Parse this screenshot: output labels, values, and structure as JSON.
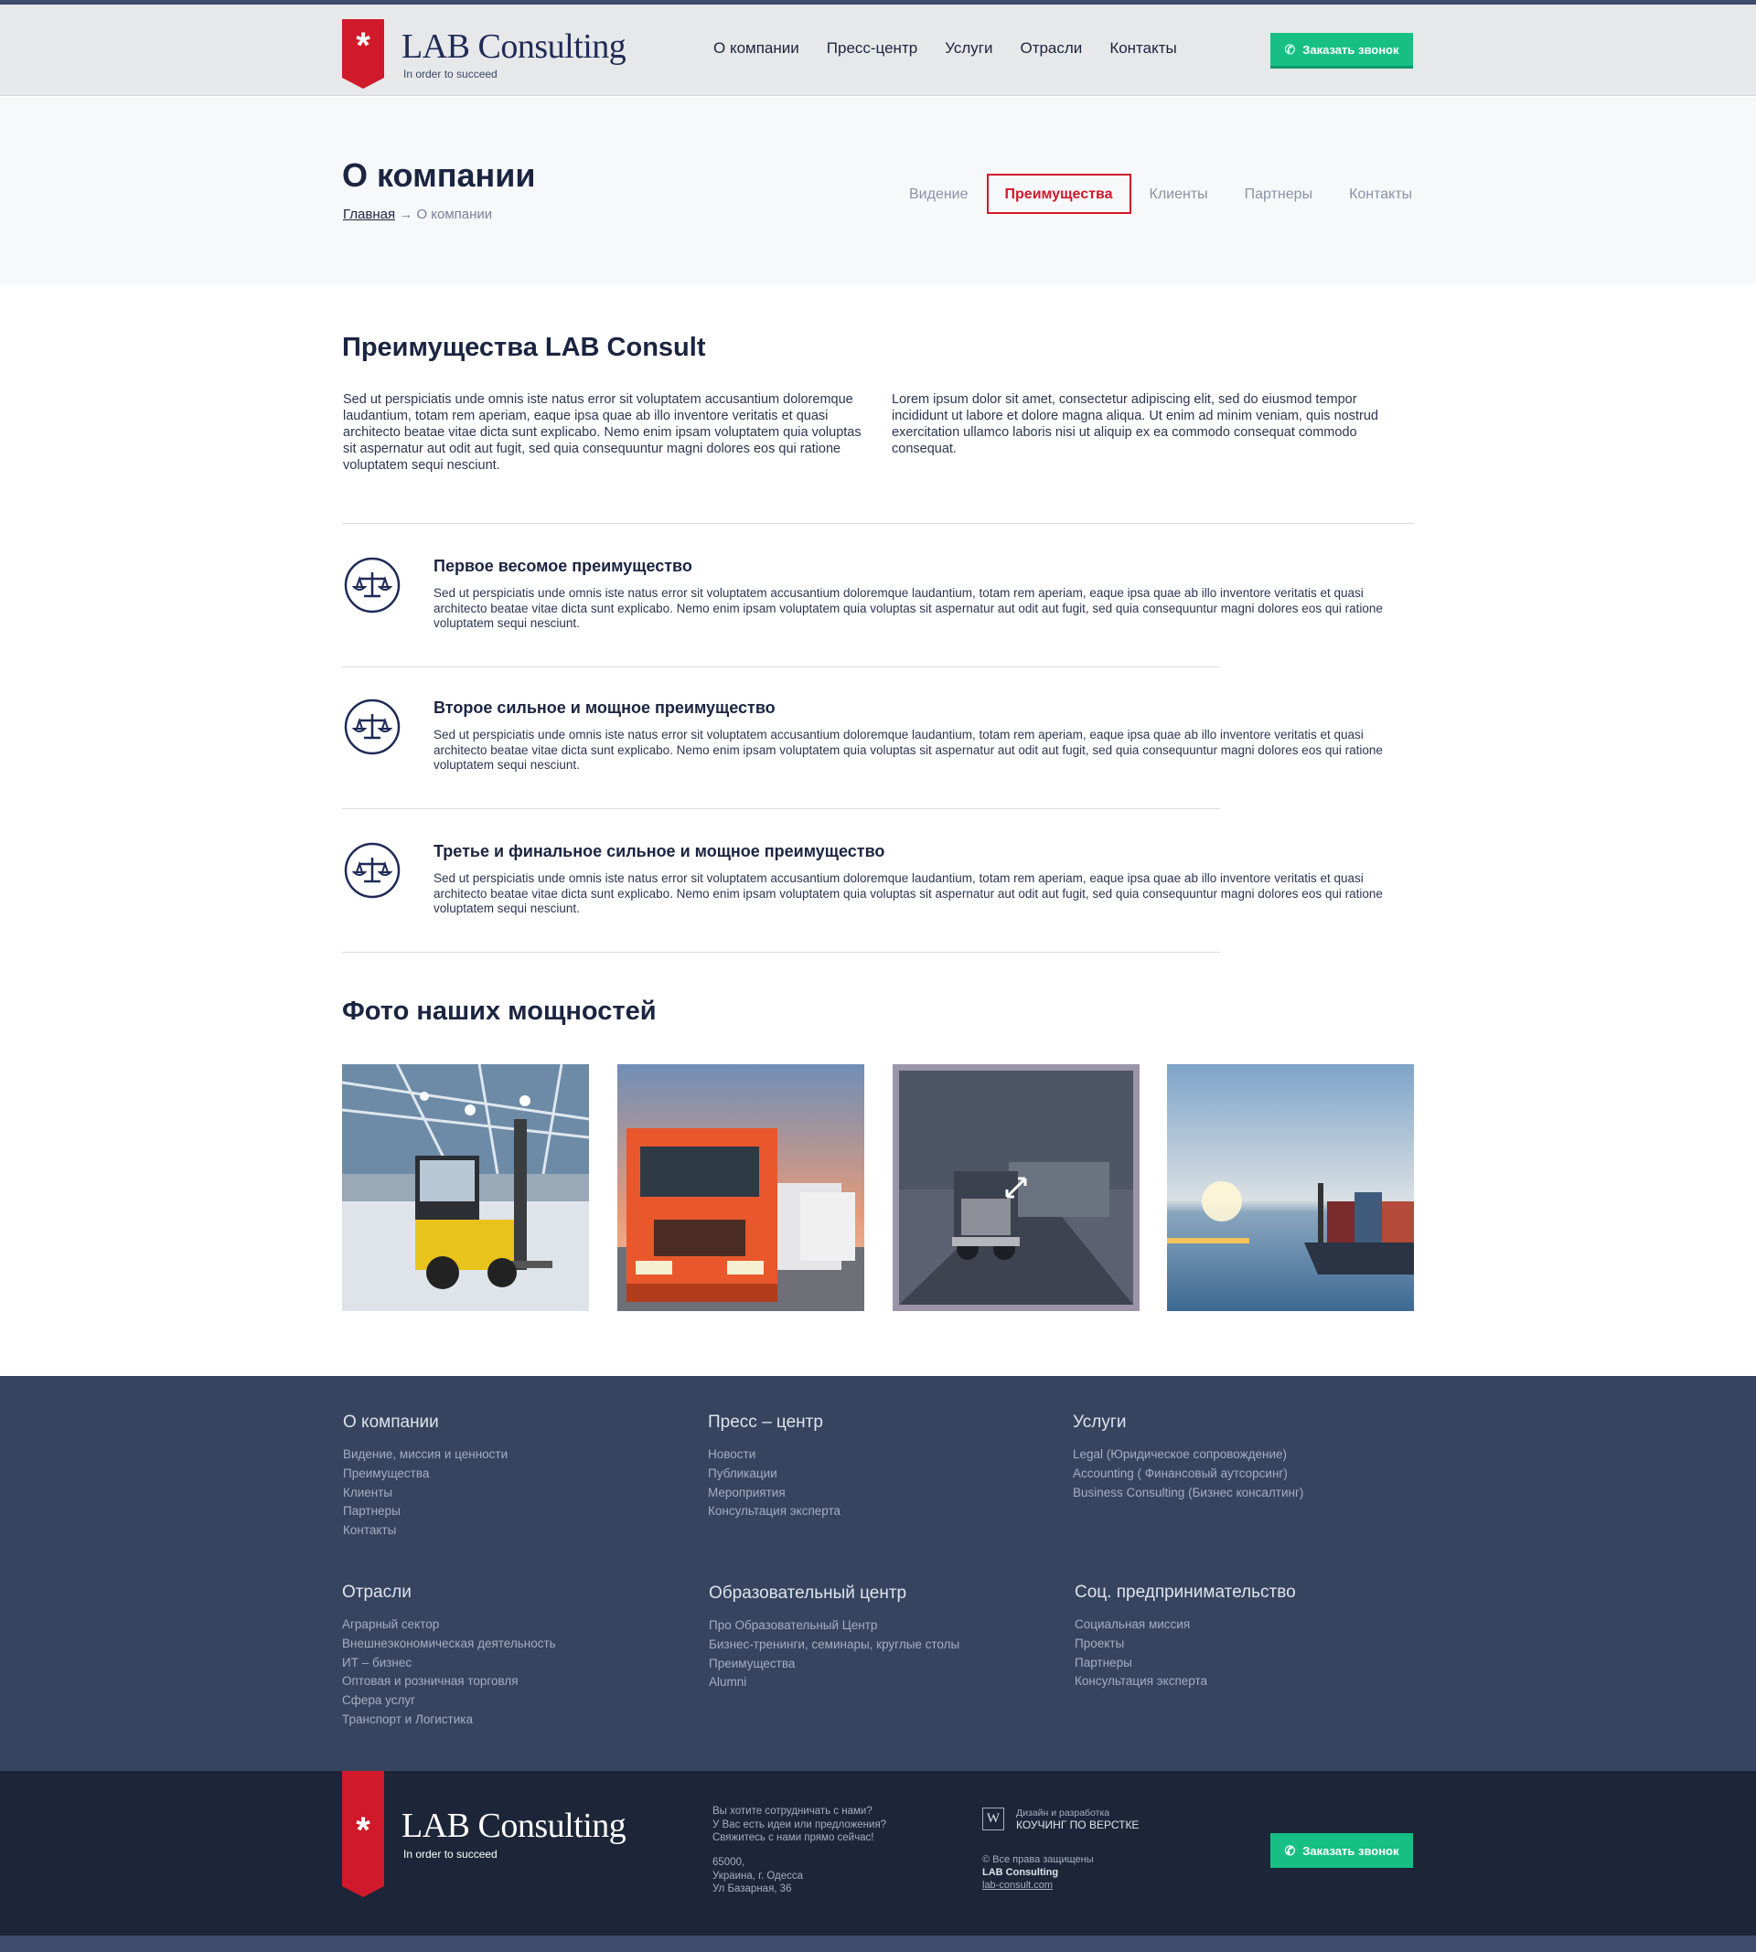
{
  "brand": {
    "name": "LAB Consulting",
    "tagline": "In order to succeed",
    "star": "*",
    "accent": "#d0192a",
    "green": "#17bf85"
  },
  "nav": [
    "О компании",
    "Пресс-центр",
    "Услуги",
    "Отрасли",
    "Контакты"
  ],
  "call_button": {
    "icon": "phone-icon",
    "label": "Заказать звонок"
  },
  "page": {
    "title": "О компании",
    "breadcrumb": {
      "home": "Главная",
      "sep": "→",
      "current": "О компании"
    },
    "tabs": [
      "Видение",
      "Преимущества",
      "Клиенты",
      "Партнеры",
      "Контакты"
    ],
    "active_tab": "Преимущества"
  },
  "advantages_section": {
    "title": "Преимущества LAB Consult",
    "intro_left": "Sed ut perspiciatis unde omnis iste natus error sit voluptatem accusantium doloremque laudantium, totam rem aperiam, eaque ipsa quae ab illo inventore veritatis et quasi architecto beatae vitae dicta sunt explicabo. Nemo enim ipsam voluptatem quia voluptas sit aspernatur aut odit aut fugit, sed quia consequuntur magni dolores eos qui ratione voluptatem sequi nesciunt.",
    "intro_right": "Lorem ipsum dolor sit amet, consectetur adipiscing elit, sed do eiusmod tempor incididunt ut labore et dolore magna aliqua. Ut enim ad minim veniam, quis nostrud exercitation ullamco laboris nisi ut aliquip ex ea commodo consequat commodo consequat.",
    "items": [
      {
        "icon": "scales-icon",
        "title": "Первое весомое преимущество",
        "text": "Sed ut perspiciatis unde omnis iste natus error sit voluptatem accusantium doloremque laudantium, totam rem aperiam, eaque ipsa quae ab illo inventore veritatis et quasi architecto beatae vitae dicta sunt explicabo. Nemo enim ipsam voluptatem quia voluptas sit aspernatur aut odit aut fugit, sed quia consequuntur magni dolores eos qui ratione voluptatem sequi nesciunt."
      },
      {
        "icon": "scales-icon",
        "title": "Второе сильное и мощное преимущество",
        "text": "Sed ut perspiciatis unde omnis iste natus error sit voluptatem accusantium doloremque laudantium, totam rem aperiam, eaque ipsa quae ab illo inventore veritatis et quasi architecto beatae vitae dicta sunt explicabo. Nemo enim ipsam voluptatem quia voluptas sit aspernatur aut odit aut fugit, sed quia consequuntur magni dolores eos qui ratione voluptatem sequi nesciunt."
      },
      {
        "icon": "scales-icon",
        "title": "Третье и финальное сильное и мощное преимущество",
        "text": "Sed ut perspiciatis unde omnis iste natus error sit voluptatem accusantium doloremque laudantium, totam rem aperiam, eaque ipsa quae ab illo inventore veritatis et quasi architecto beatae vitae dicta sunt explicabo. Nemo enim ipsam voluptatem quia voluptas sit aspernatur aut odit aut fugit, sed quia consequuntur magni dolores eos qui ratione voluptatem sequi nesciunt."
      }
    ]
  },
  "photos_section": {
    "title": "Фото наших мощностей",
    "photos": [
      "forklift-photo",
      "trucks-photo",
      "truck-road-photo",
      "cargo-ship-photo"
    ],
    "expand_icon": "expand-icon"
  },
  "footer": {
    "columns": [
      {
        "title": "О компании",
        "items": [
          "Видение, миссия и ценности",
          "Преимущества",
          "Клиенты",
          "Партнеры",
          "Контакты"
        ]
      },
      {
        "title": "Пресс – центр",
        "items": [
          "Новости",
          "Публикации",
          "Мероприятия",
          "Консультация эксперта"
        ]
      },
      {
        "title": "Услуги",
        "items": [
          "Legal (Юридическое сопровождение)",
          "Accounting ( Финансовый аутсорсинг)",
          "Business Consulting (Бизнес консалтинг)"
        ]
      },
      {
        "title": "Отрасли",
        "items": [
          "Аграрный сектор",
          "Внешнеэкономическая деятельность",
          "ИТ – бизнес",
          "Оптовая и розничная торговля",
          "Сфера услуг",
          "Транспорт и Логистика"
        ]
      },
      {
        "title": "Образовательный центр",
        "items": [
          "Про Образовательный Центр",
          "Бизнес-тренинги, семинары, круглые столы",
          "Преимущества",
          "Alumni"
        ]
      },
      {
        "title": "Соц. предпринимательство",
        "items": [
          "Социальная миссия",
          "Проекты",
          "Партнеры",
          "Консультация эксперта"
        ]
      }
    ],
    "contact_lines": [
      "Вы хотите сотрудничать с нами?",
      "У Вас есть идеи или предложения?",
      "Свяжитесь с нами прямо сейчас!"
    ],
    "address_lines": [
      "65000,",
      "Украина, г. Одесса",
      "Ул Базарная, 36"
    ],
    "design_label": "Дизайн и разработка",
    "design_name": "КОУЧИНГ ПО ВЕРСТКЕ",
    "design_icon": "W",
    "rights": "© Все права защищены",
    "company": "LAB Consulting",
    "site": "lab-consult.com"
  }
}
